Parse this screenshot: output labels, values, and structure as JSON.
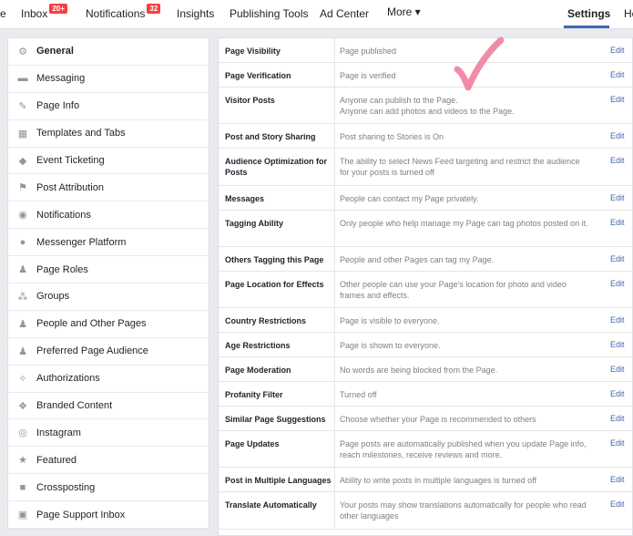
{
  "nav": {
    "partial_left": "e",
    "inbox": "Inbox",
    "inbox_badge": "20+",
    "notifications": "Notifications",
    "notifications_badge": "32",
    "insights": "Insights",
    "publishing_tools": "Publishing Tools",
    "ad_center": "Ad Center",
    "more": "More ▾",
    "settings": "Settings",
    "partial_right": "He"
  },
  "sidebar": {
    "items": [
      {
        "label": "General",
        "icon": "⚙"
      },
      {
        "label": "Messaging",
        "icon": "▬"
      },
      {
        "label": "Page Info",
        "icon": "✎"
      },
      {
        "label": "Templates and Tabs",
        "icon": "▦"
      },
      {
        "label": "Event Ticketing",
        "icon": "◆"
      },
      {
        "label": "Post Attribution",
        "icon": "⚑"
      },
      {
        "label": "Notifications",
        "icon": "◉"
      },
      {
        "label": "Messenger Platform",
        "icon": "●"
      },
      {
        "label": "Page Roles",
        "icon": "♟"
      },
      {
        "label": "Groups",
        "icon": "⁂"
      },
      {
        "label": "People and Other Pages",
        "icon": "♟"
      },
      {
        "label": "Preferred Page Audience",
        "icon": "♟"
      },
      {
        "label": "Authorizations",
        "icon": "✧"
      },
      {
        "label": "Branded Content",
        "icon": "❖"
      },
      {
        "label": "Instagram",
        "icon": "◎"
      },
      {
        "label": "Featured",
        "icon": "★"
      },
      {
        "label": "Crossposting",
        "icon": "■"
      },
      {
        "label": "Page Support Inbox",
        "icon": "▣"
      }
    ]
  },
  "settings": {
    "edit_label": "Edit",
    "rows": [
      {
        "name": "Page Visibility",
        "desc": "Page published"
      },
      {
        "name": "Page Verification",
        "desc": "Page is verified"
      },
      {
        "name": "Visitor Posts",
        "desc": "Anyone can publish to the Page.\nAnyone can add photos and videos to the Page."
      },
      {
        "name": "Post and Story Sharing",
        "desc": "Post sharing to Stories is On"
      },
      {
        "name": "Audience Optimization for Posts",
        "desc": "The ability to select News Feed targeting and restrict the audience for your posts is turned off"
      },
      {
        "name": "Messages",
        "desc": "People can contact my Page privately."
      },
      {
        "name": "Tagging Ability",
        "desc": "Only people who help manage my Page can tag photos posted on it."
      },
      {
        "name": "Others Tagging this Page",
        "desc": "People and other Pages can tag my Page."
      },
      {
        "name": "Page Location for Effects",
        "desc": "Other people can use your Page's location for photo and video frames and effects."
      },
      {
        "name": "Country Restrictions",
        "desc": "Page is visible to everyone."
      },
      {
        "name": "Age Restrictions",
        "desc": "Page is shown to everyone."
      },
      {
        "name": "Page Moderation",
        "desc": "No words are being blocked from the Page."
      },
      {
        "name": "Profanity Filter",
        "desc": "Turned off"
      },
      {
        "name": "Similar Page Suggestions",
        "desc": "Choose whether your Page is recommended to others"
      },
      {
        "name": "Page Updates",
        "desc": "Page posts are automatically published when you update Page info, reach milestones, receive reviews and more."
      },
      {
        "name": "Post in Multiple Languages",
        "desc": "Ability to write posts in multiple languages is turned off"
      },
      {
        "name": "Translate Automatically",
        "desc": "Your posts may show translations automatically for people who read other languages"
      }
    ]
  },
  "colors": {
    "accent": "#4267b2",
    "badge": "#fa3e3e",
    "checkmark": "#f28ba8"
  }
}
